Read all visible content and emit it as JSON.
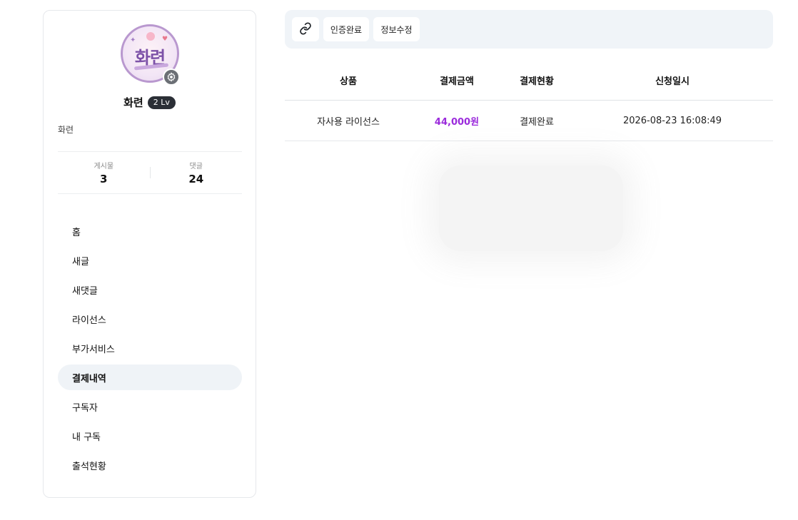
{
  "profile": {
    "avatar_text": "화련",
    "name": "화련",
    "level": "2 Lv",
    "nickname": "화련",
    "stats": {
      "posts_label": "게시물",
      "posts_value": "3",
      "comments_label": "댓글",
      "comments_value": "24"
    }
  },
  "menu": {
    "items": [
      {
        "label": "홈",
        "active": false
      },
      {
        "label": "새글",
        "active": false
      },
      {
        "label": "새댓글",
        "active": false
      },
      {
        "label": "라이선스",
        "active": false
      },
      {
        "label": "부가서비스",
        "active": false
      },
      {
        "label": "결제내역",
        "active": true
      },
      {
        "label": "구독자",
        "active": false
      },
      {
        "label": "내 구독",
        "active": false
      },
      {
        "label": "출석현황",
        "active": false
      }
    ]
  },
  "toolbar": {
    "verify_label": "인증완료",
    "edit_label": "정보수정"
  },
  "table": {
    "headers": [
      "상품",
      "결제금액",
      "결제현황",
      "신청일시"
    ],
    "rows": [
      {
        "product": "자사용 라이선스",
        "amount": "44,000원",
        "status": "결제완료",
        "date": "2026-08-23 16:08:49"
      }
    ]
  },
  "colors": {
    "accent_amount": "#9b2bdc",
    "active_menu_bg": "#eff3f7",
    "toolbar_bg": "#f0f4f8",
    "badge_bg": "#2b2f36"
  },
  "icons": {
    "link": "link-icon",
    "settings": "gear-icon"
  }
}
